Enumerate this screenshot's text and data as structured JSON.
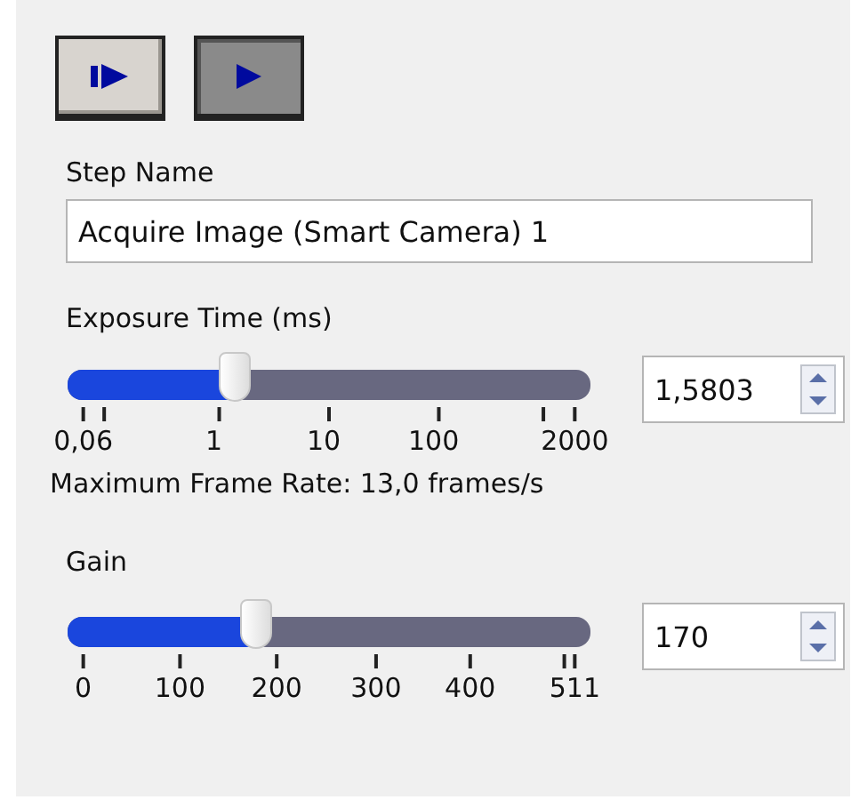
{
  "buttons": [
    {
      "kind": "step",
      "pressed": false
    },
    {
      "kind": "run",
      "pressed": true
    }
  ],
  "step_name": {
    "label": "Step Name",
    "value": "Acquire Image (Smart Camera) 1"
  },
  "exposure": {
    "label": "Exposure Time (ms)",
    "level": 0.32,
    "ticks": [
      "0,06",
      "1",
      "10",
      "100",
      "2000"
    ],
    "value": "1,5803"
  },
  "frame_rate": "Maximum Frame Rate: 13,0 frames/s",
  "gain": {
    "label": "Gain",
    "level": 0.36,
    "ticks": [
      "0",
      "100",
      "200",
      "300",
      "400",
      "511"
    ],
    "value": "170"
  }
}
